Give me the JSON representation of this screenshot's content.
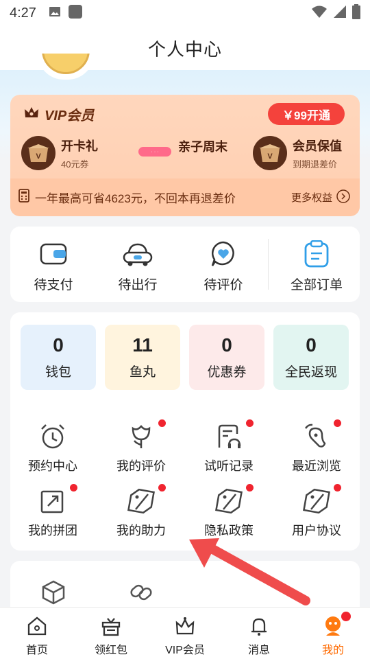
{
  "status": {
    "time": "4:27"
  },
  "nav": {
    "title": "个人中心"
  },
  "vip": {
    "title": "VIP会员",
    "open_button": "￥99开通",
    "benefits": [
      {
        "name": "开卡礼",
        "sub": "40元券"
      },
      {
        "name": "会员保值",
        "sub": "到期退差价"
      }
    ],
    "middle_name": "亲子周末",
    "footer_text": "一年最高可省4623元，不回本再退差价",
    "more_label": "更多权益"
  },
  "orders": [
    {
      "label": "待支付",
      "icon": "wallet-icon"
    },
    {
      "label": "待出行",
      "icon": "car-icon"
    },
    {
      "label": "待评价",
      "icon": "heart-chat-icon"
    },
    {
      "label": "全部订单",
      "icon": "clipboard-icon"
    }
  ],
  "assets": [
    {
      "value": "0",
      "label": "钱包",
      "color": "#e6f1fc"
    },
    {
      "value": "11",
      "label": "鱼丸",
      "color": "#fff4de"
    },
    {
      "value": "0",
      "label": "优惠券",
      "color": "#fdeaea"
    },
    {
      "value": "0",
      "label": "全民返现",
      "color": "#e2f5f1"
    }
  ],
  "tools": [
    {
      "label": "预约中心",
      "icon": "alarm-clock-icon",
      "dot": false
    },
    {
      "label": "我的评价",
      "icon": "flower-icon",
      "dot": true
    },
    {
      "label": "试听记录",
      "icon": "headphone-doc-icon",
      "dot": true
    },
    {
      "label": "最近浏览",
      "icon": "footprint-icon",
      "dot": true
    },
    {
      "label": "我的拼团",
      "icon": "share-box-icon",
      "dot": true
    },
    {
      "label": "我的助力",
      "icon": "tag-icon",
      "dot": true
    },
    {
      "label": "隐私政策",
      "icon": "tag-icon",
      "dot": true
    },
    {
      "label": "用户协议",
      "icon": "tag-icon",
      "dot": true
    }
  ],
  "tabs": [
    {
      "label": "首页",
      "icon": "home-icon"
    },
    {
      "label": "领红包",
      "icon": "gift-icon"
    },
    {
      "label": "VIP会员",
      "icon": "crown-icon"
    },
    {
      "label": "消息",
      "icon": "bell-icon"
    },
    {
      "label": "我的",
      "icon": "profile-icon",
      "active": true
    }
  ],
  "colors": {
    "accent": "#ff6a00",
    "vip_button": "#f4423c",
    "arrow": "#ef4c4c",
    "badge": "#f0242f"
  }
}
